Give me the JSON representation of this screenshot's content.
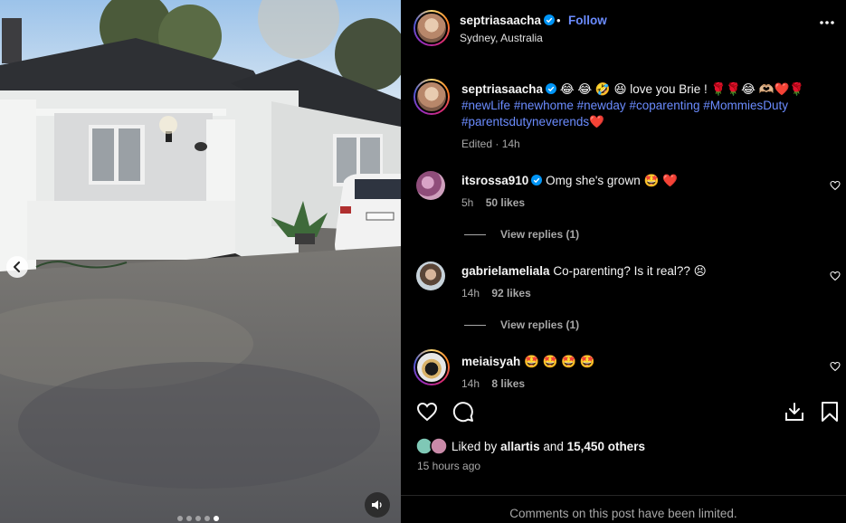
{
  "post": {
    "username": "septriasaacha",
    "separator": "•",
    "follow_label": "Follow",
    "location": "Sydney, Australia",
    "more_icon": "more-horizontal-icon"
  },
  "caption": {
    "username": "septriasaacha",
    "text": "😂 😂 🤣 😆  love you Brie ! 🌹🌹😂 🫶🏼❤️🌹",
    "hashtags": [
      "#newLife",
      "#newhome",
      "#newday",
      "#coparenting",
      "#MommiesDuty",
      "#parentsdutyneverends"
    ],
    "trailing_emoji": "❤️",
    "meta": "Edited · 14h"
  },
  "comments": [
    {
      "username": "itsrossa910",
      "verified": true,
      "text": "Omg she's grown 🤩 ❤️",
      "time": "5h",
      "likes": "50 likes",
      "replies": "View replies (1)"
    },
    {
      "username": "gabrielameliala",
      "verified": false,
      "text": "Co-parenting? Is it real?? 😣",
      "time": "14h",
      "likes": "92 likes",
      "replies": "View replies (1)"
    },
    {
      "username": "meiaisyah",
      "verified": false,
      "text": "🤩 🤩 🤩 🤩",
      "time": "14h",
      "likes": "8 likes",
      "replies": ""
    }
  ],
  "footer": {
    "liked_by_prefix": "Liked by",
    "liked_by_user": "allartis",
    "liked_by_and": "and",
    "liked_by_count": "15,450 others",
    "posted_ago": "15 hours ago",
    "limited_notice": "Comments on this post have been limited."
  },
  "carousel": {
    "slide_count": 5,
    "active_index": 4
  },
  "colors": {
    "background": "#000000",
    "link": "#6b8cff",
    "muted": "#a8a8a8",
    "verified": "#0095f6"
  }
}
